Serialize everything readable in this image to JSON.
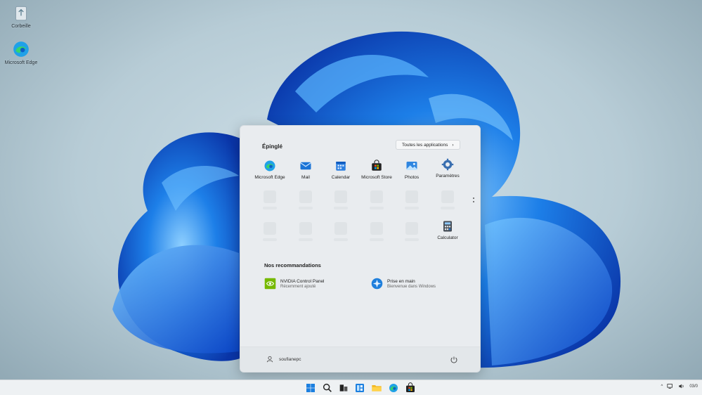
{
  "desktop": {
    "icons": [
      {
        "label": "Corbeille",
        "icon": "recycle-bin-icon"
      },
      {
        "label": "Microsoft Edge",
        "icon": "edge-icon"
      }
    ]
  },
  "start_menu": {
    "pinned_title": "Épinglé",
    "all_apps_label": "Toutes les applications",
    "all_apps_chevron": "›",
    "pinned": [
      {
        "label": "Microsoft Edge",
        "icon": "edge-icon"
      },
      {
        "label": "Mail",
        "icon": "mail-icon"
      },
      {
        "label": "Calendar",
        "icon": "calendar-icon"
      },
      {
        "label": "Microsoft Store",
        "icon": "store-icon"
      },
      {
        "label": "Photos",
        "icon": "photos-icon"
      },
      {
        "label": "Paramètres",
        "icon": "settings-icon"
      },
      {
        "label": "Calculator",
        "icon": "calculator-icon"
      }
    ],
    "recommendations_title": "Nos recommandations",
    "recommendations": [
      {
        "title": "NVIDIA Control Panel",
        "subtitle": "Récemment ajouté",
        "icon": "nvidia-icon"
      },
      {
        "title": "Prise en main",
        "subtitle": "Bienvenue dans Windows",
        "icon": "get-started-icon"
      }
    ],
    "user_name": "soufianepc",
    "power_icon": "power-icon"
  },
  "taskbar": {
    "icons": [
      "windows-start-icon",
      "search-icon",
      "task-view-icon",
      "widgets-icon",
      "file-explorer-icon",
      "edge-icon",
      "store-icon"
    ],
    "tray_chevron": "^",
    "clock_partial": "03/0"
  },
  "colors": {
    "accent": "#0a6cd6",
    "bloom_light": "#3fa3f0",
    "bloom_dark": "#0b3fb8"
  }
}
